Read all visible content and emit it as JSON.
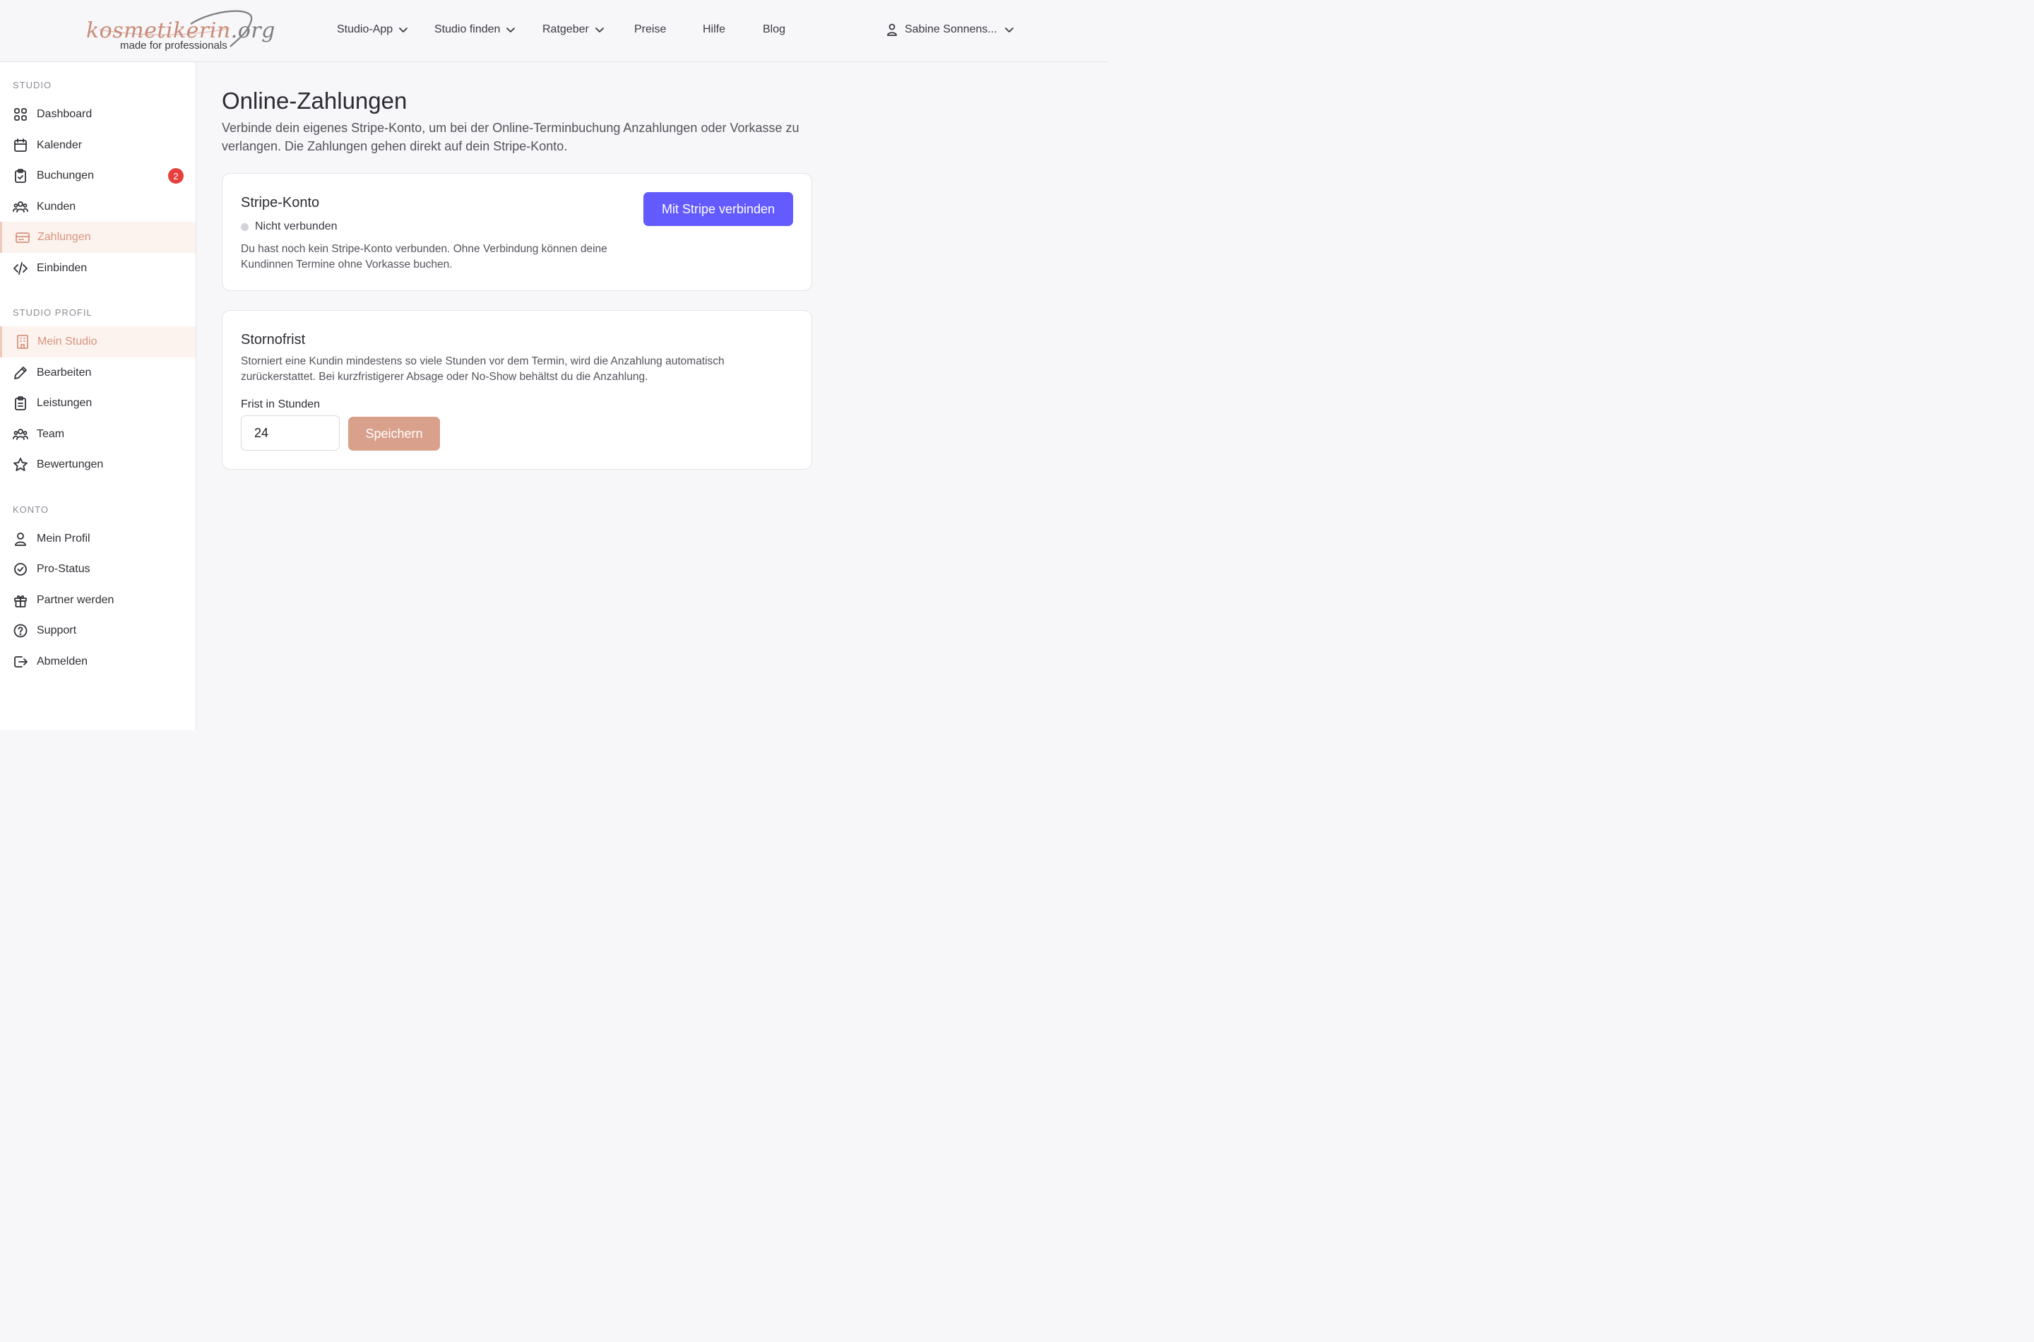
{
  "brand": {
    "logo_main": "kosmetikerin",
    "logo_domain": ".org",
    "tagline": "made for professionals",
    "accent": "#c98b77"
  },
  "nav": {
    "items": [
      {
        "label": "Studio-App",
        "has_dropdown": true
      },
      {
        "label": "Studio finden",
        "has_dropdown": true
      },
      {
        "label": "Ratgeber",
        "has_dropdown": true
      },
      {
        "label": "Preise",
        "has_dropdown": false
      },
      {
        "label": "Hilfe",
        "has_dropdown": false
      },
      {
        "label": "Blog",
        "has_dropdown": false
      }
    ],
    "user_name": "Sabine Sonnens..."
  },
  "sidebar": {
    "sections": [
      {
        "title": "STUDIO",
        "items": [
          {
            "label": "Dashboard",
            "icon": "grid-icon"
          },
          {
            "label": "Kalender",
            "icon": "calendar-icon"
          },
          {
            "label": "Buchungen",
            "icon": "clipboard-check-icon",
            "badge": "2"
          },
          {
            "label": "Kunden",
            "icon": "users-icon"
          },
          {
            "label": "Zahlungen",
            "icon": "credit-card-icon",
            "active": true
          },
          {
            "label": "Einbinden",
            "icon": "code-icon"
          }
        ]
      },
      {
        "title": "STUDIO PROFIL",
        "items": [
          {
            "label": "Mein Studio",
            "icon": "building-icon",
            "active": true
          },
          {
            "label": "Bearbeiten",
            "icon": "pencil-icon"
          },
          {
            "label": "Leistungen",
            "icon": "clipboard-list-icon"
          },
          {
            "label": "Team",
            "icon": "users-icon"
          },
          {
            "label": "Bewertungen",
            "icon": "star-icon"
          }
        ]
      },
      {
        "title": "KONTO",
        "items": [
          {
            "label": "Mein Profil",
            "icon": "user-icon"
          },
          {
            "label": "Pro-Status",
            "icon": "check-circle-icon"
          },
          {
            "label": "Partner werden",
            "icon": "gift-icon"
          },
          {
            "label": "Support",
            "icon": "help-circle-icon"
          },
          {
            "label": "Abmelden",
            "icon": "logout-icon"
          }
        ]
      }
    ],
    "badge_color": "#e5403e"
  },
  "main": {
    "title": "Online-Zahlungen",
    "description": "Verbinde dein eigenes Stripe-Konto, um bei der Online-Terminbuchung Anzahlungen oder Vorkasse zu verlangen. Die Zahlungen gehen direkt auf dein Stripe-Konto.",
    "stripe_card": {
      "title": "Stripe-Konto",
      "status": "Nicht verbunden",
      "text": "Du hast noch kein Stripe-Konto verbunden. Ohne Verbindung können deine Kundinnen Termine ohne Vorkasse buchen.",
      "button_label": "Mit Stripe verbinden",
      "button_color": "#635bff"
    },
    "storno_card": {
      "title": "Stornofrist",
      "text": "Storniert eine Kundin mindestens so viele Stunden vor dem Termin, wird die Anzahlung automatisch zurückerstattet. Bei kurzfristigerer Absage oder No-Show behältst du die Anzahlung.",
      "field_label": "Frist in Stunden",
      "field_value": "24",
      "save_label": "Speichern",
      "save_color": "#d9a08c"
    }
  }
}
